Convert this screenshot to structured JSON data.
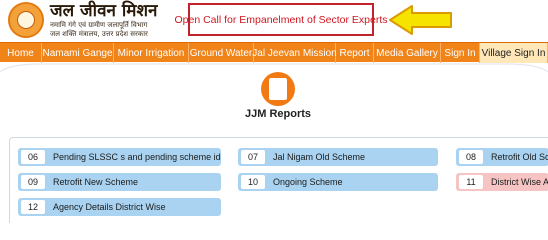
{
  "header": {
    "brand_title": "जल जीवन मिशन",
    "brand_sub_1": "नमामि गंगे एवं ग्रामीण जलापूर्ति विभाग",
    "brand_sub_2": "जल शक्ति मंत्रालय, उत्तर प्रदेश सरकार",
    "notice": "Open Call for Empanelment of Sector Experts",
    "colors": {
      "notice_border": "#c0232b",
      "arrow_fill": "#f6e400",
      "arrow_stroke": "#d89b00"
    }
  },
  "nav": {
    "items": [
      {
        "label": "Home"
      },
      {
        "label": "Namami Gange"
      },
      {
        "label": "Minor Irrigation"
      },
      {
        "label": "Ground Water"
      },
      {
        "label": "Jal Jeevan Mission"
      },
      {
        "label": "Report"
      },
      {
        "label": "Media Gallery"
      },
      {
        "label": "Sign In"
      },
      {
        "label": "Village Sign In"
      }
    ],
    "colors": {
      "bar": "#f08419",
      "active": "#ffe7b8"
    }
  },
  "main": {
    "title": "JJM Reports",
    "cards": [
      {
        "num": "06",
        "label": "Pending SLSSC s and pending scheme id"
      },
      {
        "num": "07",
        "label": "Jal Nigam Old Scheme"
      },
      {
        "num": "08",
        "label": "Retrofit Old Scheme"
      },
      {
        "num": "09",
        "label": "Retrofit New Scheme"
      },
      {
        "num": "10",
        "label": "Ongoing Scheme"
      },
      {
        "num": "11",
        "label": "District Wise Agency"
      },
      {
        "num": "12",
        "label": "Agency Details District Wise"
      }
    ],
    "colors": {
      "card": "#a9d3f0",
      "card_alert": "#f7c4c4",
      "icon": "#f27a14"
    }
  }
}
